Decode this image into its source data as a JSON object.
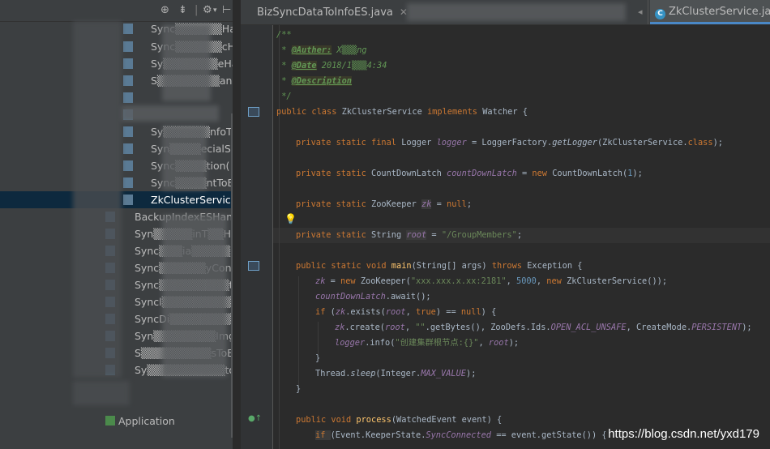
{
  "project_panel": {
    "header_icons": [
      "target-icon",
      "collapse-icon",
      "gear-icon",
      "hide-icon"
    ],
    "tree_items": [
      {
        "label": "Sync▒▒▒▒▒▒Han",
        "selected": false
      },
      {
        "label": "Sync▒▒▒▒▒▒cHan",
        "selected": false
      },
      {
        "label": "Sy▒▒▒▒▒▒▒eHa",
        "selected": false
      },
      {
        "label": "S▒▒▒▒▒▒▒▒and",
        "selected": false
      },
      {
        "label": "",
        "selected": false
      },
      {
        "label": "",
        "selected": false
      },
      {
        "label": "Sy▒▒▒▒▒▒nfoT",
        "selected": false
      },
      {
        "label": "Syn▒▒▒▒ecialS",
        "selected": false
      },
      {
        "label": "Sync▒▒▒▒tion(",
        "selected": false
      },
      {
        "label": "Sync▒▒▒▒ntToE",
        "selected": false
      },
      {
        "label": "ZkClusterService",
        "selected": true
      },
      {
        "label": "BackupIndexESHand",
        "selected": false
      },
      {
        "label": "Syn▒▒▒▒▒inT▒▒Har",
        "selected": false
      },
      {
        "label": "Sync▒▒▒ia▒▒▒▒▒nd",
        "selected": false
      },
      {
        "label": "Sync▒▒▒▒▒▒yContTo",
        "selected": false
      },
      {
        "label": "Sync▒▒▒▒▒▒▒▒▒toE",
        "selected": false
      },
      {
        "label": "Syncl▒▒▒▒▒▒▒▒▒oE",
        "selected": false
      },
      {
        "label": "SyncDi▒▒▒▒▒▒▒▒Ar",
        "selected": false
      },
      {
        "label": "Syn▒▒▒▒▒▒▒▒Img",
        "selected": false
      },
      {
        "label": "S▒▒▒▒▒▒▒▒▒sToE",
        "selected": false
      },
      {
        "label": "Sy▒▒▒▒▒▒▒▒▒▒tor",
        "selected": false
      }
    ],
    "application_label": "Application"
  },
  "tabs": [
    {
      "label": "BizSyncDataToInfoES.java",
      "active": false,
      "closable": true
    },
    {
      "label": "ZkClusterService.java",
      "active": true,
      "closable": false
    }
  ],
  "code": {
    "c1": "/**",
    "c2_tag": "@Auther:",
    "c2_val": " X▒▒▒ng",
    "c3_tag": "@Date",
    "c3_val": " 2018/1▒▒▒4:34",
    "c4_tag": "@Description",
    "c5": " */",
    "class_decl": [
      "public class ",
      "ZkClusterService ",
      "implements ",
      "Watcher {"
    ],
    "logger": [
      "private static final ",
      "Logger ",
      "logger",
      " = LoggerFactory.",
      "getLogger",
      "(ZkClusterService.",
      "class",
      ");"
    ],
    "latch": [
      "private static ",
      "CountDownLatch ",
      "countDownLatch",
      " = ",
      "new ",
      "CountDownLatch(",
      "1",
      ");"
    ],
    "zk": [
      "private static ",
      "ZooKeeper ",
      "zk",
      " = ",
      "null",
      ";"
    ],
    "root": [
      "private static ",
      "String ",
      "root",
      " = ",
      "\"/GroupMembers\"",
      ";"
    ],
    "main": [
      "public static void ",
      "main",
      "(String[] args) ",
      "throws ",
      "Exception {"
    ],
    "m1": [
      "zk",
      " = ",
      "new ",
      "ZooKeeper(",
      "\"xxx.xxx.x.xx:2181\"",
      ", ",
      "5000",
      ", ",
      "new ",
      "ZkClusterService());"
    ],
    "m2": [
      "countDownLatch",
      ".await();"
    ],
    "m3": [
      "if ",
      "(",
      "zk",
      ".exists(",
      "root",
      ", ",
      "true",
      ") == ",
      "null",
      ") {"
    ],
    "m4": [
      "zk",
      ".create(",
      "root",
      ", ",
      "\"\"",
      ".getBytes(), ZooDefs.Ids.",
      "OPEN_ACL_UNSAFE",
      ", CreateMode.",
      "PERSISTENT",
      ");"
    ],
    "m5": [
      "logger",
      ".info(",
      "\"创建集群根节点:{}\"",
      ", ",
      "root",
      ");"
    ],
    "m6": "}",
    "m7": [
      "Thread.",
      "sleep",
      "(Integer.",
      "MAX_VALUE",
      ");"
    ],
    "m8": "}",
    "process": [
      "public void ",
      "process",
      "(WatchedEvent event) {"
    ],
    "p1": [
      "if ",
      "(Event.KeeperState.",
      "SyncConnected",
      " == event.getState()) {"
    ]
  },
  "watermark": "https://blog.csdn.net/yxd179"
}
